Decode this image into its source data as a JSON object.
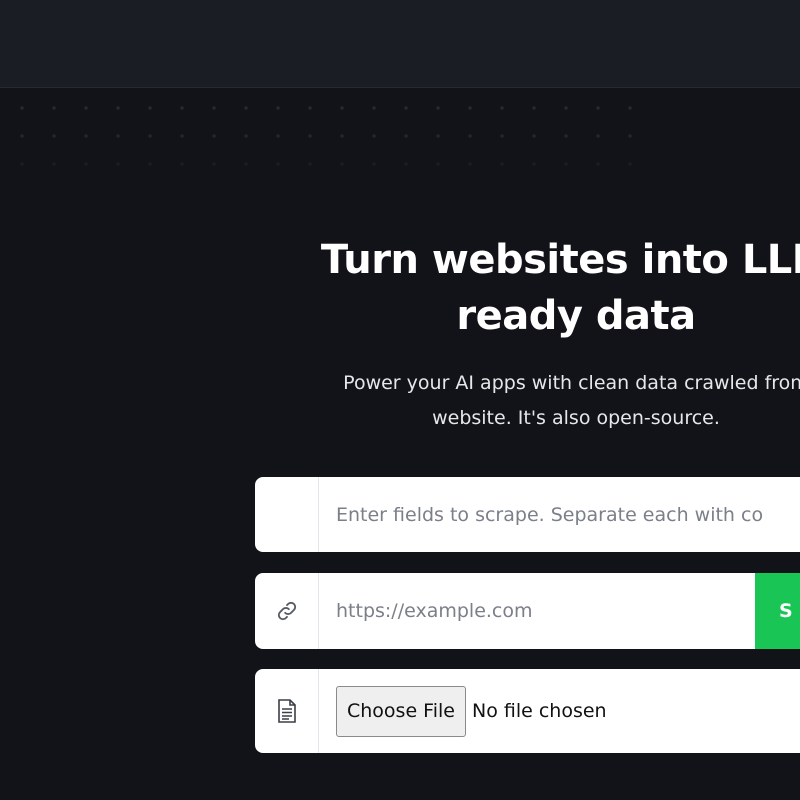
{
  "hero": {
    "title_line1": "Turn websites into LLM",
    "title_line2": "ready data",
    "subtitle_line1": "Power your AI apps with clean data crawled from",
    "subtitle_line2": "website. It's also open-source."
  },
  "form": {
    "fields_placeholder": "Enter fields to scrape. Separate each with co",
    "url_placeholder": "https://example.com",
    "submit_label": "S",
    "file_button_label": "Choose File",
    "file_status": "No file chosen"
  },
  "colors": {
    "background": "#111318",
    "topbar": "#1b1d25",
    "accent_green": "#19c655"
  },
  "icons": {
    "url": "link-icon",
    "file": "document-icon"
  }
}
